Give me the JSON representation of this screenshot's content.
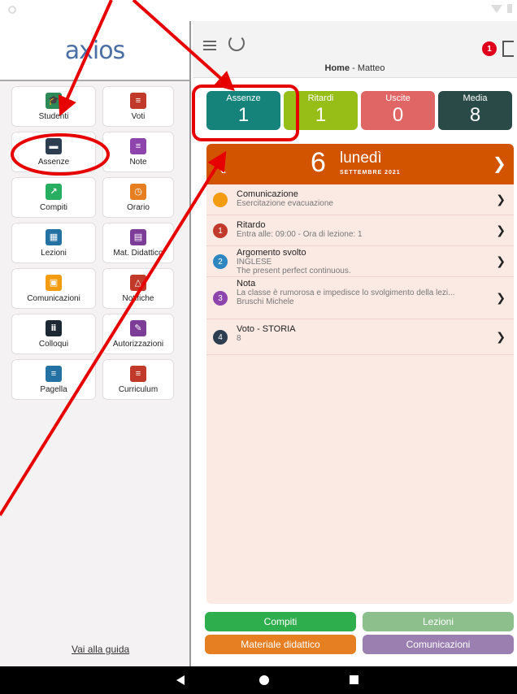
{
  "sidebar": {
    "logo": "axios",
    "tiles": [
      {
        "label": "Studenti",
        "icon": "graduation-cap-icon",
        "color": "#2e8b57",
        "glyph": "🎓"
      },
      {
        "label": "Voti",
        "icon": "notebook-icon",
        "color": "#c0392b",
        "glyph": "≡"
      },
      {
        "label": "Assenze",
        "icon": "bed-icon",
        "color": "#2c3e50",
        "glyph": "▬"
      },
      {
        "label": "Note",
        "icon": "note-icon",
        "color": "#8e44ad",
        "glyph": "≡"
      },
      {
        "label": "Compiti",
        "icon": "chart-board-icon",
        "color": "#27ae60",
        "glyph": "↗"
      },
      {
        "label": "Orario",
        "icon": "clock-icon",
        "color": "#e67e22",
        "glyph": "◷"
      },
      {
        "label": "Lezioni",
        "icon": "classroom-icon",
        "color": "#2471a3",
        "glyph": "▦"
      },
      {
        "label": "Mat. Didattico",
        "icon": "books-icon",
        "color": "#7d3c98",
        "glyph": "▤"
      },
      {
        "label": "Comunicazioni",
        "icon": "document-icon",
        "color": "#f39c12",
        "glyph": "▣"
      },
      {
        "label": "Notifiche",
        "icon": "bell-icon",
        "color": "#c0392b",
        "glyph": "△"
      },
      {
        "label": "Colloqui",
        "icon": "people-icon",
        "color": "#1c2833",
        "glyph": "ⅱ"
      },
      {
        "label": "Autorizzazioni",
        "icon": "signature-icon",
        "color": "#7d3c98",
        "glyph": "✎"
      },
      {
        "label": "Pagella",
        "icon": "report-card-icon",
        "color": "#2471a3",
        "glyph": "≡"
      },
      {
        "label": "Curriculum",
        "icon": "curriculum-icon",
        "color": "#c0392b",
        "glyph": "≡"
      }
    ],
    "guide_link": "Vai alla guida"
  },
  "header": {
    "title_bold": "Home",
    "title_rest": " - Matteo",
    "notification_count": "1"
  },
  "stats": [
    {
      "label": "Assenze",
      "value": "1",
      "color": "#16837b"
    },
    {
      "label": "Ritardi",
      "value": "1",
      "color": "#97bd17"
    },
    {
      "label": "Uscite",
      "value": "0",
      "color": "#e06666"
    },
    {
      "label": "Media",
      "value": "8",
      "color": "#2a4a47"
    }
  ],
  "date": {
    "day_number": "6",
    "day_name": "lunedì",
    "month_year": "SETTEMBRE 2021",
    "prev": "❮",
    "next": "❯"
  },
  "events": [
    {
      "badge": "",
      "badge_color": "#f39c12",
      "title": "Comunicazione",
      "detail": "Esercitazione evacuazione",
      "detail2": ""
    },
    {
      "badge": "1",
      "badge_color": "#c0392b",
      "title": "Ritardo",
      "detail": "Entra alle: 09:00 - Ora di lezione: 1",
      "detail2": ""
    },
    {
      "badge": "2",
      "badge_color": "#2e86c1",
      "title": "Argomento svolto",
      "detail": "INGLESE",
      "detail2": "The present perfect continuous."
    },
    {
      "badge": "3",
      "badge_color": "#8e44ad",
      "title": "Nota",
      "detail": "La classe è rumorosa e impedisce lo svolgimento della lezi...",
      "detail2": "Bruschi Michele"
    },
    {
      "badge": "4",
      "badge_color": "#2c3e50",
      "title": "Voto - STORIA",
      "detail": "8",
      "detail2": ""
    }
  ],
  "buttons": [
    {
      "label": "Compiti",
      "color": "#2fae4e"
    },
    {
      "label": "Lezioni",
      "color": "#8cbf8c"
    },
    {
      "label": "Materiale didattico",
      "color": "#e67e22"
    },
    {
      "label": "Comunicazioni",
      "color": "#9b7fb0"
    }
  ],
  "annotation_color": "#e60000"
}
